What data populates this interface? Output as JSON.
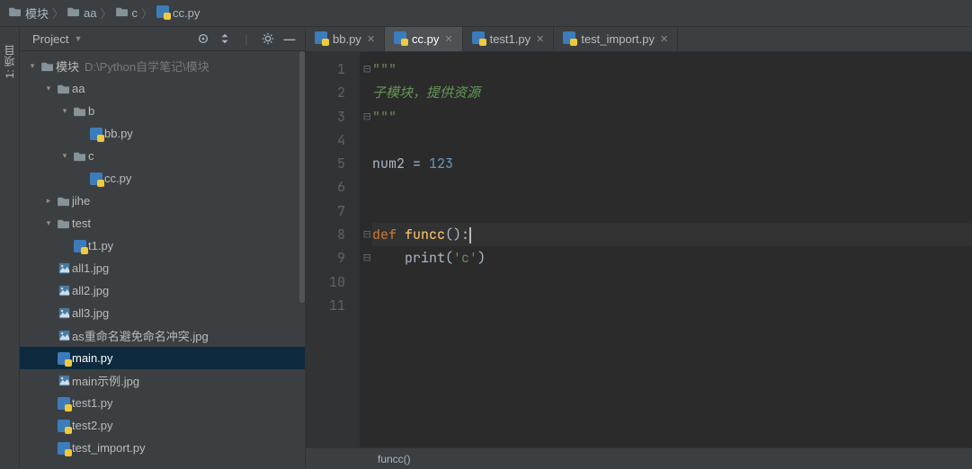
{
  "breadcrumb": [
    {
      "label": "模块",
      "icon": "folder"
    },
    {
      "label": "aa",
      "icon": "folder"
    },
    {
      "label": "c",
      "icon": "folder"
    },
    {
      "label": "cc.py",
      "icon": "py"
    }
  ],
  "sidebar_tab": "1: 项目",
  "panel": {
    "title": "Project",
    "tools": [
      "target",
      "autoscroll",
      "divider",
      "gear",
      "minimize"
    ]
  },
  "tree": [
    {
      "depth": 0,
      "arrow": "down",
      "icon": "folder",
      "label": "模块",
      "dim": "D:\\Python自学笔记\\模块"
    },
    {
      "depth": 1,
      "arrow": "down",
      "icon": "folder",
      "label": "aa"
    },
    {
      "depth": 2,
      "arrow": "down",
      "icon": "folder",
      "label": "b"
    },
    {
      "depth": 3,
      "arrow": "",
      "icon": "py",
      "label": "bb.py"
    },
    {
      "depth": 2,
      "arrow": "down",
      "icon": "folder",
      "label": "c"
    },
    {
      "depth": 3,
      "arrow": "",
      "icon": "py",
      "label": "cc.py"
    },
    {
      "depth": 1,
      "arrow": "right",
      "icon": "folder",
      "label": "jihe"
    },
    {
      "depth": 1,
      "arrow": "down",
      "icon": "folder",
      "label": "test"
    },
    {
      "depth": 2,
      "arrow": "",
      "icon": "py",
      "label": "t1.py"
    },
    {
      "depth": 1,
      "arrow": "",
      "icon": "img",
      "label": "all1.jpg"
    },
    {
      "depth": 1,
      "arrow": "",
      "icon": "img",
      "label": "all2.jpg"
    },
    {
      "depth": 1,
      "arrow": "",
      "icon": "img",
      "label": "all3.jpg"
    },
    {
      "depth": 1,
      "arrow": "",
      "icon": "img",
      "label": "as重命名避免命名冲突.jpg"
    },
    {
      "depth": 1,
      "arrow": "",
      "icon": "py",
      "label": "main.py",
      "selected": true
    },
    {
      "depth": 1,
      "arrow": "",
      "icon": "img",
      "label": "main示例.jpg"
    },
    {
      "depth": 1,
      "arrow": "",
      "icon": "py",
      "label": "test1.py"
    },
    {
      "depth": 1,
      "arrow": "",
      "icon": "py",
      "label": "test2.py"
    },
    {
      "depth": 1,
      "arrow": "",
      "icon": "py",
      "label": "test_import.py"
    }
  ],
  "tabs": [
    {
      "label": "bb.py",
      "icon": "py",
      "active": false
    },
    {
      "label": "cc.py",
      "icon": "py",
      "active": true
    },
    {
      "label": "test1.py",
      "icon": "py",
      "active": false
    },
    {
      "label": "test_import.py",
      "icon": "py",
      "active": false
    }
  ],
  "code": {
    "lines": [
      {
        "n": 1,
        "mark": "⊖",
        "tokens": [
          [
            "\"\"\"",
            "str"
          ]
        ]
      },
      {
        "n": 2,
        "tokens": [
          [
            "子模块，提供资源",
            "comment"
          ]
        ]
      },
      {
        "n": 3,
        "mark": "⊖",
        "tokens": [
          [
            "\"\"\"",
            "str"
          ]
        ]
      },
      {
        "n": 4,
        "tokens": []
      },
      {
        "n": 5,
        "tokens": [
          [
            "num2 ",
            "plain"
          ],
          [
            "= ",
            "plain"
          ],
          [
            "123",
            "num"
          ]
        ]
      },
      {
        "n": 6,
        "tokens": []
      },
      {
        "n": 7,
        "tokens": []
      },
      {
        "n": 8,
        "current": true,
        "mark": "⊖",
        "tokens": [
          [
            "def ",
            "kw"
          ],
          [
            "funcc",
            "fn"
          ],
          [
            "():",
            "plain"
          ]
        ],
        "cursor": true
      },
      {
        "n": 9,
        "mark": "⊖",
        "tokens": [
          [
            "    ",
            "plain"
          ],
          [
            "print",
            "builtin"
          ],
          [
            "(",
            "plain"
          ],
          [
            "'c'",
            "str"
          ],
          [
            ")",
            "plain"
          ]
        ]
      },
      {
        "n": 10,
        "tokens": []
      },
      {
        "n": 11,
        "tokens": []
      }
    ]
  },
  "status": "funcc()"
}
